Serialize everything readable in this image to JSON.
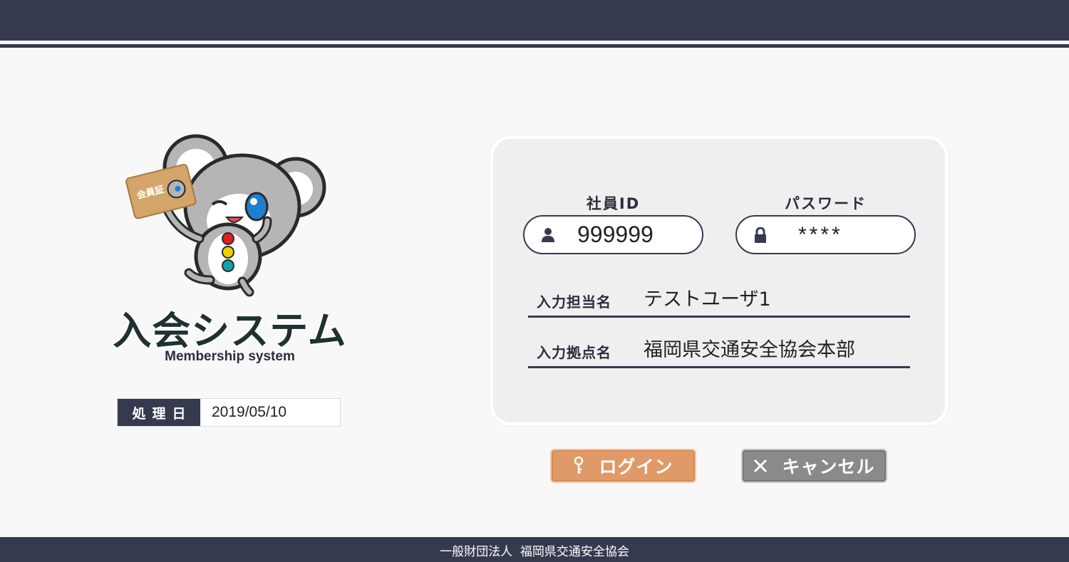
{
  "header": {},
  "app": {
    "title": "入会システム",
    "subtitle": "Membership system",
    "card_label": "会員証"
  },
  "processing_date": {
    "label": "処理日",
    "value": "2019/05/10"
  },
  "login": {
    "employee_id_label": "社員ID",
    "employee_id_value": "999999",
    "password_label": "パスワード",
    "password_value": "****",
    "operator_label": "入力担当名",
    "operator_value": "テストユーザ1",
    "branch_label": "入力拠点名",
    "branch_value": "福岡県交通安全協会本部"
  },
  "buttons": {
    "login_label": "ログイン",
    "login_icon": "key-icon",
    "cancel_label": "キャンセル",
    "cancel_icon": "close-icon"
  },
  "footer": {
    "org_type": "一般財団法人",
    "org_name": "福岡県交通安全協会"
  },
  "colors": {
    "navy": "#363a4f",
    "login_orange": "#e09a67",
    "cancel_gray": "#8a8a8a",
    "background": "#f8f8f9"
  }
}
